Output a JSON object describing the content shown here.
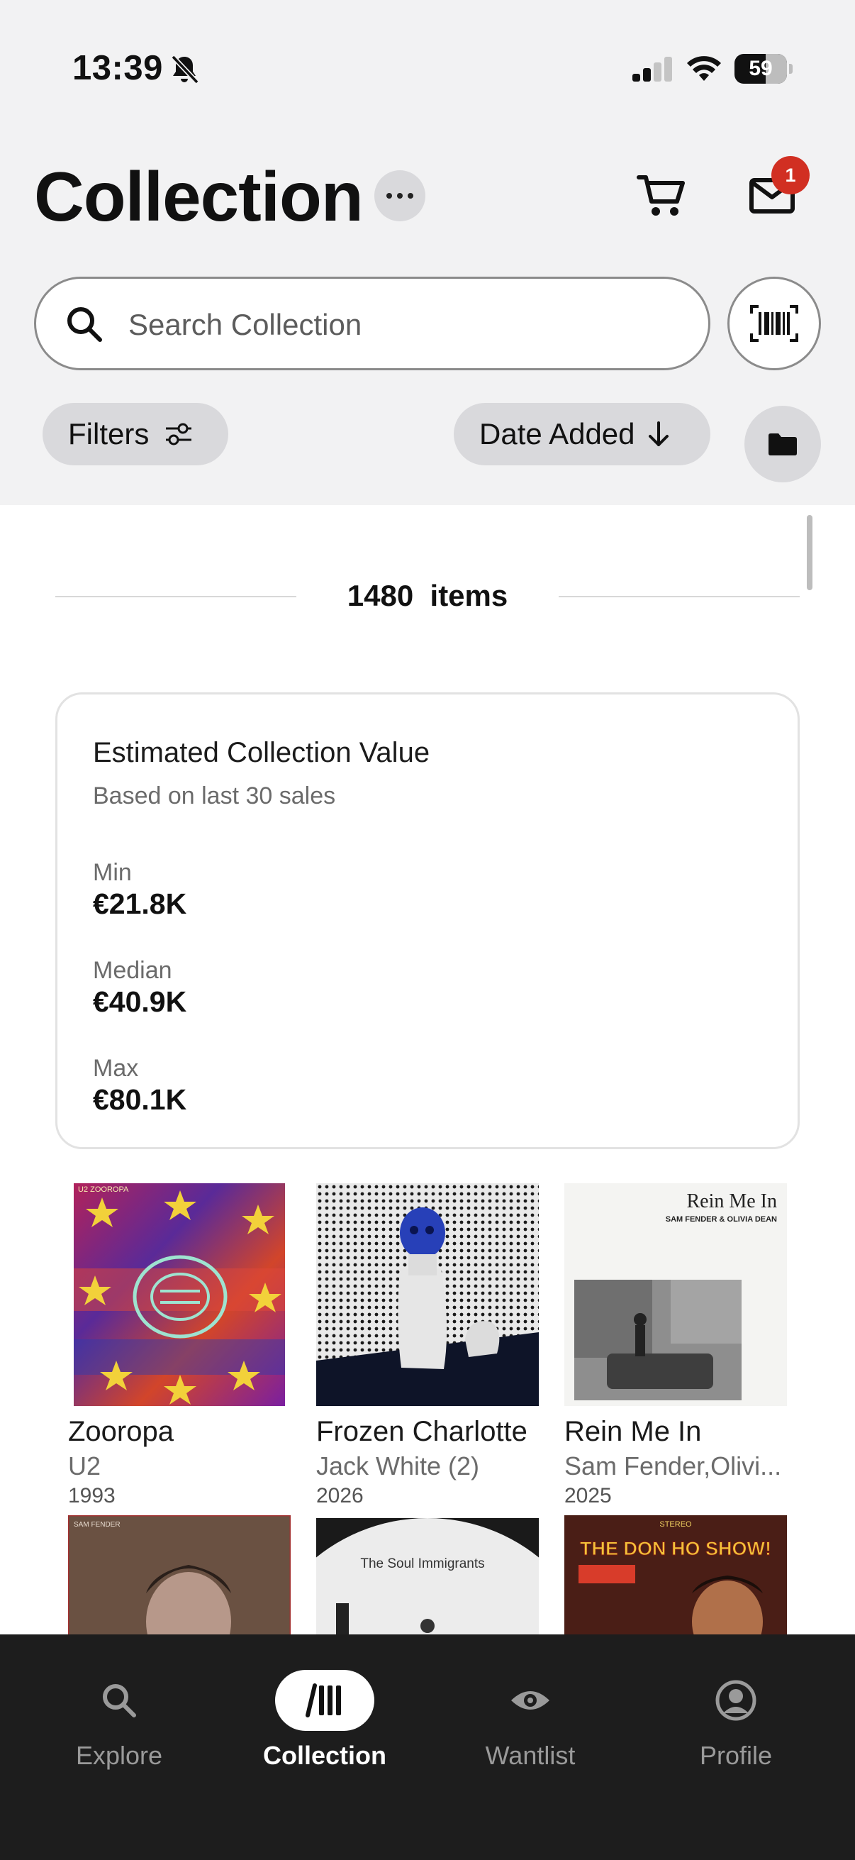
{
  "status": {
    "time": "13:39",
    "battery": "59",
    "battery_percent": 59
  },
  "header": {
    "title": "Collection",
    "mail_badge": "1"
  },
  "search": {
    "placeholder": "Search Collection"
  },
  "toolbar": {
    "filters_label": "Filters",
    "sort_label": "Date Added"
  },
  "collection": {
    "count_number": "1480",
    "count_unit": "items"
  },
  "value_card": {
    "title": "Estimated Collection Value",
    "subtitle": "Based on last 30 sales",
    "min_label": "Min",
    "min_value": "€21.8K",
    "median_label": "Median",
    "median_value": "€40.9K",
    "max_label": "Max",
    "max_value": "€80.1K"
  },
  "records": [
    {
      "title": "Zooropa",
      "artist": "U2",
      "year": "1993",
      "cover_text": "U2 ZOOROPA"
    },
    {
      "title": "Frozen Charlotte",
      "artist": "Jack White (2)",
      "year": "2026"
    },
    {
      "title": "Rein Me In",
      "artist": "Sam Fender,Olivi...",
      "year": "2025",
      "cover_title": "Rein Me In",
      "cover_subtitle": "SAM FENDER & OLIVIA DEAN"
    }
  ],
  "records_row2": [
    {
      "cover_text": "SAM FENDER"
    },
    {
      "cover_text": "The Soul Immigrants"
    },
    {
      "cover_text": "THE DON HO SHOW!",
      "cover_topline": "STEREO"
    }
  ],
  "tabs": [
    {
      "label": "Explore",
      "icon": "search-icon"
    },
    {
      "label": "Collection",
      "icon": "collection-icon",
      "active": true
    },
    {
      "label": "Wantlist",
      "icon": "eye-icon"
    },
    {
      "label": "Profile",
      "icon": "profile-icon"
    }
  ],
  "colors": {
    "badge": "#d12f22",
    "tab_bar": "#1d1d1d",
    "chip": "#d9d9dc"
  }
}
